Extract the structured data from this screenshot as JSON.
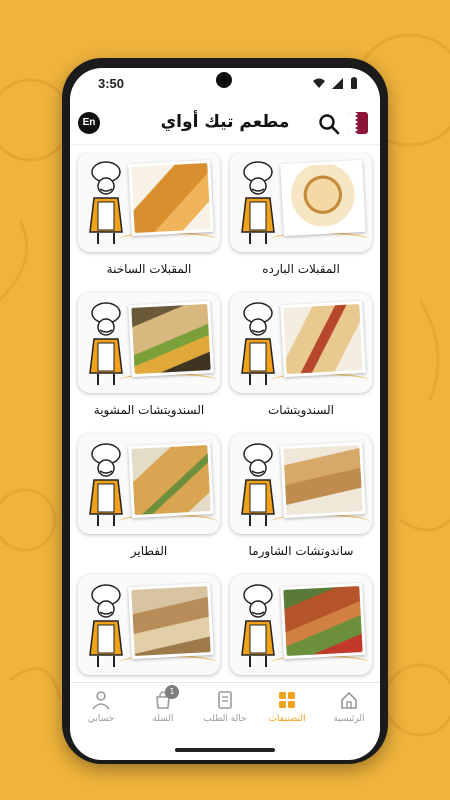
{
  "status": {
    "time": "3:50"
  },
  "header": {
    "title": "مطعم تيك أواي",
    "lang_button": "En"
  },
  "categories": [
    {
      "label": "المقبلات البارده",
      "food": "hummus"
    },
    {
      "label": "المقبلات الساخنة",
      "food": "samosa"
    },
    {
      "label": "السندويتشات",
      "food": "wrap"
    },
    {
      "label": "السندويتشات المشوية",
      "food": "grilled-wrap"
    },
    {
      "label": "ساندوتشات الشاورما",
      "food": "shawarma"
    },
    {
      "label": "الفطاير",
      "food": "pastry"
    },
    {
      "label": "",
      "food": "kebab"
    },
    {
      "label": "",
      "food": "rolls"
    }
  ],
  "tabbar": {
    "items": [
      {
        "label": "الرئيسية",
        "icon": "home-icon"
      },
      {
        "label": "التصنيفات",
        "icon": "grid-icon",
        "active": true
      },
      {
        "label": "حالة الطلب",
        "icon": "clipboard-icon"
      },
      {
        "label": "السلة",
        "icon": "cart-icon",
        "badge": "1"
      },
      {
        "label": "حسابي",
        "icon": "user-icon"
      }
    ]
  },
  "colors": {
    "accent": "#f0a21b",
    "background": "#f0b43c"
  }
}
